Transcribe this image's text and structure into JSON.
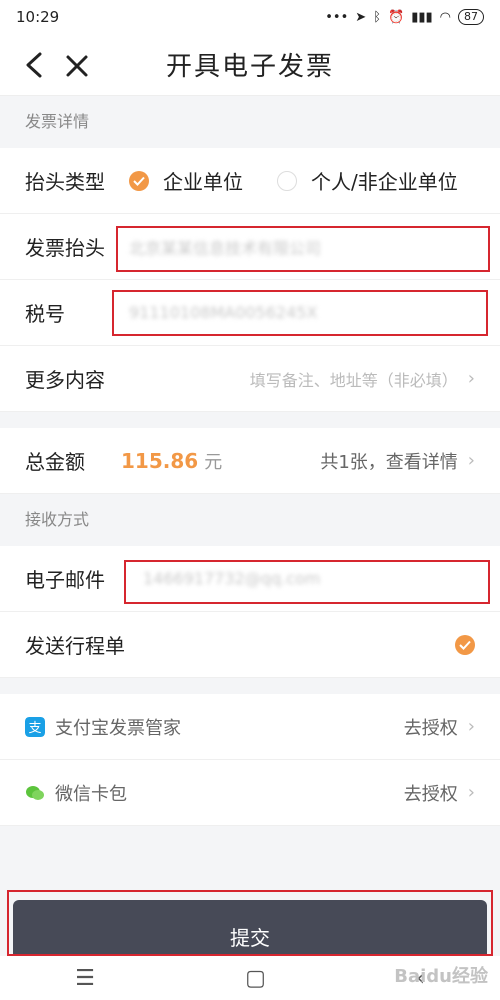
{
  "status": {
    "time": "10:29",
    "battery": "87"
  },
  "nav": {
    "title": "开具电子发票"
  },
  "invoice_section": {
    "header": "发票详情",
    "type_label": "抬头类型",
    "type_options": [
      "企业单位",
      "个人/非企业单位"
    ],
    "type_selected": "企业单位",
    "title_label": "发票抬头",
    "title_value": "北京某某信息技术有限公司",
    "tax_label": "税号",
    "tax_value": "91110108MA0056245X",
    "more_label": "更多内容",
    "more_placeholder": "填写备注、地址等（非必填）"
  },
  "total": {
    "label": "总金额",
    "amount": "115.86",
    "unit": "元",
    "detail": "共1张，查看详情"
  },
  "receive_section": {
    "header": "接收方式",
    "email_label": "电子邮件",
    "email_value": "1466917732@qq.com",
    "itinerary_label": "发送行程单"
  },
  "auth": [
    {
      "label": "支付宝发票管家",
      "action": "去授权",
      "icon": "alipay-icon",
      "color": "#1aa0e6"
    },
    {
      "label": "微信卡包",
      "action": "去授权",
      "icon": "wechat-icon",
      "color": "#5cc43c"
    }
  ],
  "submit": {
    "label": "提交"
  },
  "watermark": "Baidu经验",
  "colors": {
    "accent": "#f29846",
    "button": "#474a57",
    "highlight": "#d6262f"
  }
}
